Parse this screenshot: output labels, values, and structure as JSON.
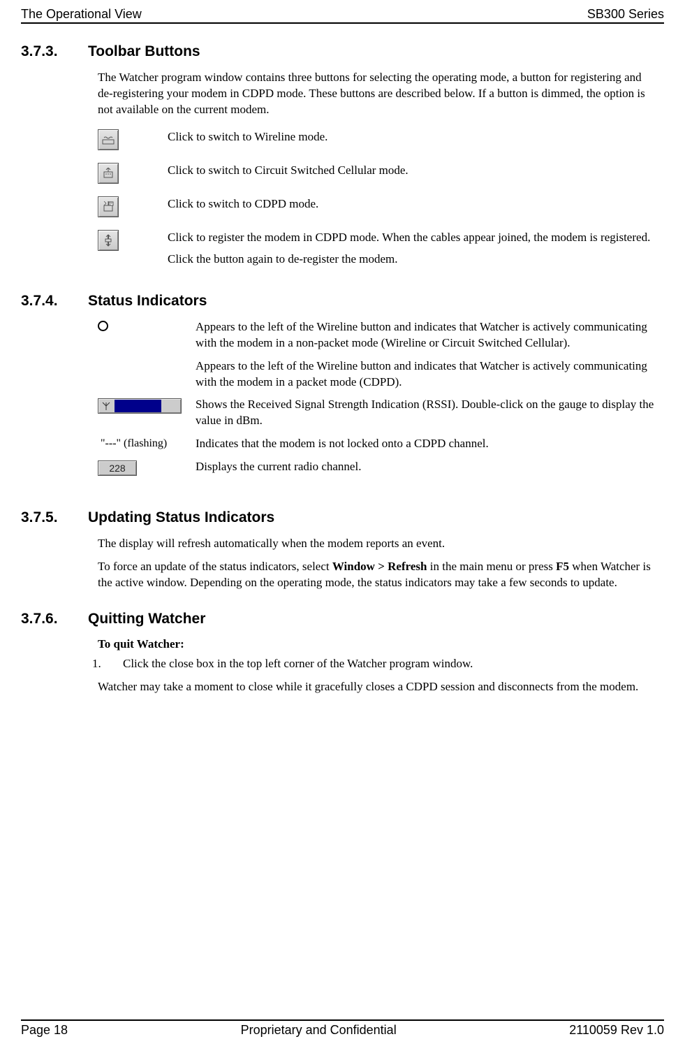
{
  "header": {
    "left": "The Operational View",
    "right": "SB300 Series"
  },
  "sections": {
    "s373": {
      "num": "3.7.3.",
      "title": "Toolbar Buttons",
      "intro": "The Watcher program window contains three buttons for selecting the operating mode, a button for registering and de-registering your modem in CDPD mode.  These buttons are described below.  If a button is dimmed, the option is not available on the current modem.",
      "rows": [
        {
          "desc": "Click to switch to Wireline mode."
        },
        {
          "desc": "Click to switch to Circuit Switched Cellular mode."
        },
        {
          "desc": "Click to switch to CDPD mode."
        },
        {
          "desc": "Click to register the modem in CDPD mode.  When the cables appear joined, the modem is registered.",
          "desc2": "Click the button again to de-register the modem."
        }
      ]
    },
    "s374": {
      "num": "3.7.4.",
      "title": "Status Indicators",
      "rows": [
        {
          "label": "",
          "desc": "Appears to the left of the Wireline button and indicates that Watcher is actively communicating with the modem in a non-packet mode (Wireline or Circuit Switched Cellular)."
        },
        {
          "label": "",
          "desc": "Appears to the left of the Wireline button and indicates that Watcher is actively communicating with the modem in a packet mode (CDPD)."
        },
        {
          "label": "",
          "desc": "Shows the Received Signal Strength Indication (RSSI). Double-click on the gauge to display the value in dBm."
        },
        {
          "label": "\"---\" (flashing)",
          "desc": "Indicates that the modem is not locked onto a CDPD channel."
        },
        {
          "label": "228",
          "desc": "Displays the current radio channel."
        }
      ]
    },
    "s375": {
      "num": "3.7.5.",
      "title": "Updating Status Indicators",
      "p1": "The display will refresh automatically when the modem reports an event.",
      "p2_pre": "To force an update of the status indicators, select ",
      "p2_bold": "Window > Refresh",
      "p2_mid": " in the main menu or press ",
      "p2_bold2": "F5",
      "p2_post": " when Watcher is the active window.  Depending on the operating mode, the status indicators may take a few seconds to update."
    },
    "s376": {
      "num": "3.7.6.",
      "title": " Quitting Watcher",
      "subhead": "To quit Watcher:",
      "step1_n": "1.",
      "step1": "Click the close box in the top left corner of the Watcher program window.",
      "p1": "Watcher may take a moment to close while it gracefully closes a CDPD session and disconnects from the modem."
    }
  },
  "footer": {
    "left": "Page 18",
    "center": "Proprietary and Confidential",
    "right": "2110059 Rev 1.0"
  }
}
